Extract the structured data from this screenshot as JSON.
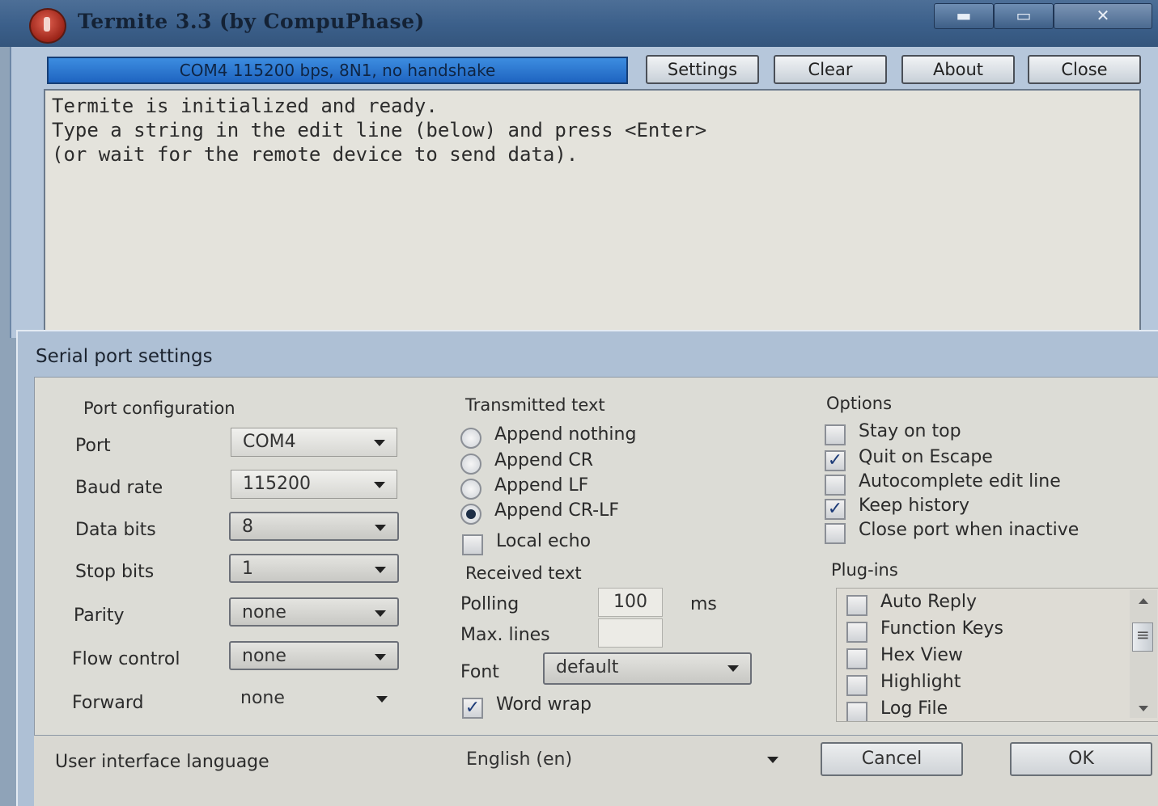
{
  "window": {
    "title": "Termite 3.3 (by CompuPhase)",
    "minimize_glyph": "▬",
    "maximize_glyph": "▭",
    "close_glyph": "✕"
  },
  "toolbar": {
    "status": "COM4 115200 bps, 8N1, no handshake",
    "settings_label": "Settings",
    "clear_label": "Clear",
    "about_label": "About",
    "close_label": "Close"
  },
  "terminal": {
    "lines": [
      "Termite is initialized and ready.",
      "Type a string in the edit line (below) and press <Enter>",
      "(or wait for the remote device to send data)."
    ]
  },
  "dialog": {
    "title": "Serial port settings",
    "port_config": {
      "title": "Port configuration",
      "fields": [
        {
          "label": "Port",
          "value": "COM4"
        },
        {
          "label": "Baud rate",
          "value": "115200"
        },
        {
          "label": "Data bits",
          "value": "8"
        },
        {
          "label": "Stop bits",
          "value": "1"
        },
        {
          "label": "Parity",
          "value": "none"
        },
        {
          "label": "Flow control",
          "value": "none"
        },
        {
          "label": "Forward",
          "value": "none"
        }
      ]
    },
    "transmitted": {
      "title": "Transmitted text",
      "options": [
        {
          "label": "Append nothing",
          "selected": false
        },
        {
          "label": "Append CR",
          "selected": false
        },
        {
          "label": "Append LF",
          "selected": false
        },
        {
          "label": "Append CR-LF",
          "selected": true
        }
      ],
      "local_echo": {
        "label": "Local echo",
        "checked": false
      }
    },
    "received": {
      "title": "Received text",
      "polling_label": "Polling",
      "polling_value": "100",
      "polling_unit": "ms",
      "max_lines_label": "Max. lines",
      "max_lines_value": "",
      "font_label": "Font",
      "font_value": "default",
      "word_wrap": {
        "label": "Word wrap",
        "checked": true
      }
    },
    "options": {
      "title": "Options",
      "items": [
        {
          "label": "Stay on top",
          "checked": false
        },
        {
          "label": "Quit on Escape",
          "checked": true
        },
        {
          "label": "Autocomplete edit line",
          "checked": false
        },
        {
          "label": "Keep history",
          "checked": true
        },
        {
          "label": "Close port when inactive",
          "checked": false
        }
      ]
    },
    "plugins": {
      "title": "Plug-ins",
      "items": [
        {
          "label": "Auto Reply",
          "checked": false
        },
        {
          "label": "Function Keys",
          "checked": false
        },
        {
          "label": "Hex View",
          "checked": false
        },
        {
          "label": "Highlight",
          "checked": false
        },
        {
          "label": "Log File",
          "checked": false
        }
      ]
    },
    "footer": {
      "language_label": "User interface language",
      "language_value": "English (en)",
      "cancel_label": "Cancel",
      "ok_label": "OK"
    }
  },
  "colors": {
    "titlebar": "#3b5f8a",
    "status_bar": "#2c78d4",
    "dialog_frame": "#aec0d5",
    "dialog_body": "#dcdcd6",
    "terminal_bg": "#e4e3dc"
  }
}
